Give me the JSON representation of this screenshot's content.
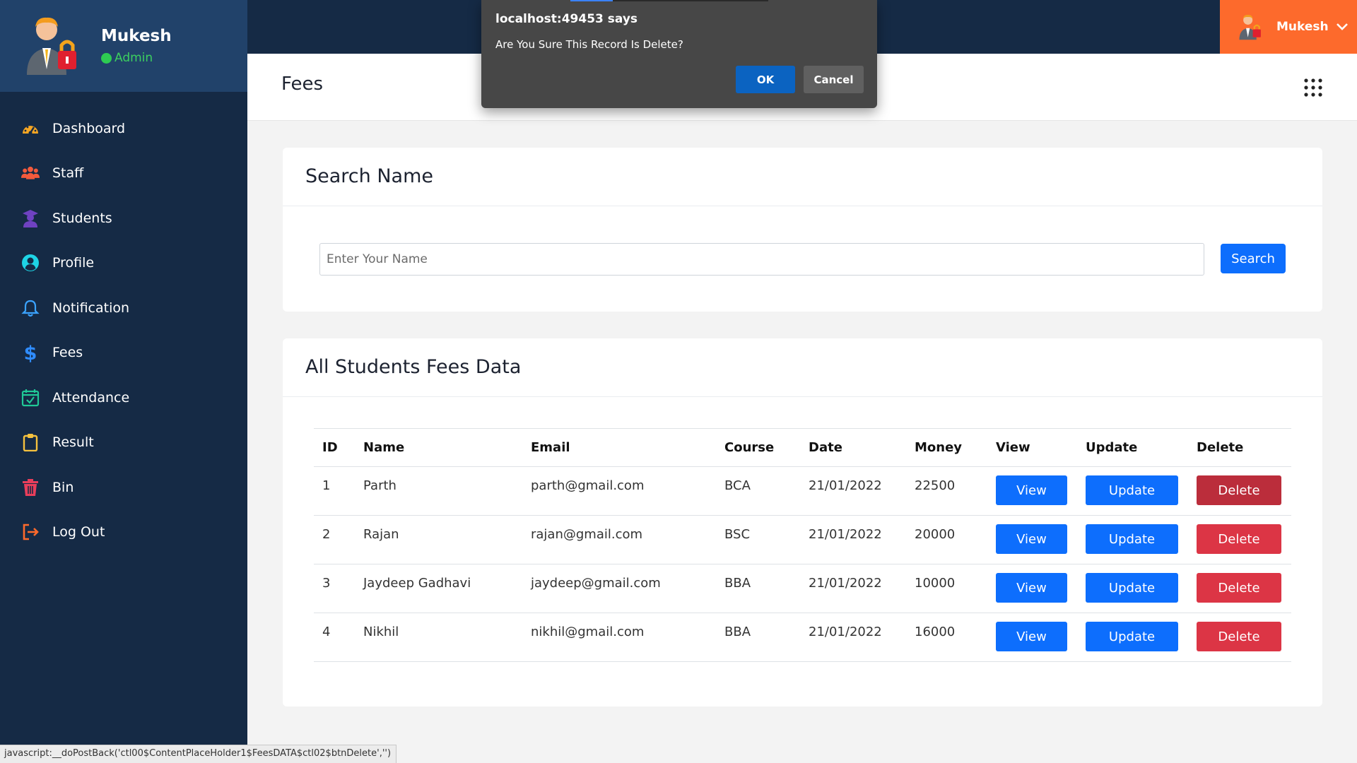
{
  "sidebar": {
    "user_name": "Mukesh",
    "user_role": "Admin",
    "items": [
      {
        "label": "Dashboard",
        "icon": "dashboard-gauge-icon",
        "color": "#f6a623"
      },
      {
        "label": "Staff",
        "icon": "users-group-icon",
        "color": "#f35a3c"
      },
      {
        "label": "Students",
        "icon": "graduate-icon",
        "color": "#6f42c1"
      },
      {
        "label": "Profile",
        "icon": "user-circle-icon",
        "color": "#1ed4e6"
      },
      {
        "label": "Notification",
        "icon": "bell-icon",
        "color": "#3ba3ff"
      },
      {
        "label": "Fees",
        "icon": "dollar-icon",
        "color": "#2f8cff"
      },
      {
        "label": "Attendance",
        "icon": "calendar-check-icon",
        "color": "#20c997"
      },
      {
        "label": "Result",
        "icon": "clipboard-icon",
        "color": "#f6c23e"
      },
      {
        "label": "Bin",
        "icon": "trash-icon",
        "color": "#e83e5b"
      },
      {
        "label": "Log Out",
        "icon": "logout-icon",
        "color": "#fd6a2c"
      }
    ]
  },
  "topbar": {
    "user_name": "Mukesh"
  },
  "header": {
    "title": "Fees"
  },
  "search": {
    "title": "Search Name",
    "placeholder": "Enter Your Name",
    "value": "",
    "button_label": "Search"
  },
  "fees_table": {
    "title": "All Students Fees Data",
    "columns": [
      "ID",
      "Name",
      "Email",
      "Course",
      "Date",
      "Money",
      "View",
      "Update",
      "Delete"
    ],
    "rows": [
      {
        "id": "1",
        "name": "Parth",
        "email": "parth@gmail.com",
        "course": "BCA",
        "date": "21/01/2022",
        "money": "22500",
        "view": "View",
        "update": "Update",
        "delete": "Delete"
      },
      {
        "id": "2",
        "name": "Rajan",
        "email": "rajan@gmail.com",
        "course": "BSC",
        "date": "21/01/2022",
        "money": "20000",
        "view": "View",
        "update": "Update",
        "delete": "Delete"
      },
      {
        "id": "3",
        "name": "Jaydeep Gadhavi",
        "email": "jaydeep@gmail.com",
        "course": "BBA",
        "date": "21/01/2022",
        "money": "10000",
        "view": "View",
        "update": "Update",
        "delete": "Delete"
      },
      {
        "id": "4",
        "name": "Nikhil",
        "email": "nikhil@gmail.com",
        "course": "BBA",
        "date": "21/01/2022",
        "money": "16000",
        "view": "View",
        "update": "Update",
        "delete": "Delete"
      }
    ]
  },
  "dialog": {
    "title": "localhost:49453 says",
    "message": "Are You Sure This Record Is Delete?",
    "ok_label": "OK",
    "cancel_label": "Cancel"
  },
  "statusbar": {
    "text": "javascript:__doPostBack('ctl00$ContentPlaceHolder1$FeesDATA$ctl02$btnDelete','')"
  },
  "colors": {
    "sidebar_bg": "#152a45",
    "profile_bg": "#21426a",
    "user_menu_bg": "#fd6a2c",
    "primary": "#0d6efd",
    "danger": "#dc3545",
    "dialog_bg": "#474747"
  }
}
